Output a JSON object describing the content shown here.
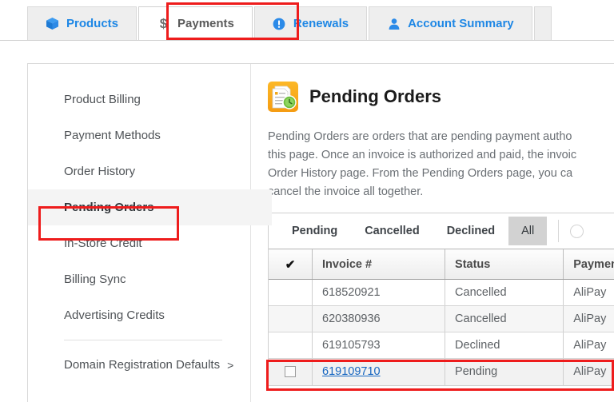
{
  "tabs": [
    {
      "label": "Products",
      "icon": "cube-icon",
      "active": false
    },
    {
      "label": "Payments",
      "icon": "dollar-icon",
      "active": true
    },
    {
      "label": "Renewals",
      "icon": "alert-circle-icon",
      "active": false
    },
    {
      "label": "Account Summary",
      "icon": "user-icon",
      "active": false
    }
  ],
  "sidebar": {
    "items": [
      {
        "label": "Product Billing",
        "active": false
      },
      {
        "label": "Payment Methods",
        "active": false
      },
      {
        "label": "Order History",
        "active": false
      },
      {
        "label": "Pending Orders",
        "active": true
      },
      {
        "label": "In-Store Credit",
        "active": false
      },
      {
        "label": "Billing Sync",
        "active": false
      },
      {
        "label": "Advertising Credits",
        "active": false
      }
    ],
    "footer_item": {
      "label": "Domain Registration Defaults",
      "chevron": ">"
    }
  },
  "main": {
    "icon": "invoice-clock-icon",
    "title": "Pending Orders",
    "intro": "Pending Orders are orders that are pending payment autho\nthis page. Once an invoice is authorized and paid, the invoic\nOrder History page. From the Pending Orders page, you ca\ncancel the invoice all together.",
    "filters": [
      {
        "label": "Pending",
        "selected": false
      },
      {
        "label": "Cancelled",
        "selected": false
      },
      {
        "label": "Declined",
        "selected": false
      },
      {
        "label": "All",
        "selected": true
      }
    ],
    "search_icon": "search-icon",
    "table": {
      "columns": [
        "",
        "Invoice #",
        "Status",
        "Payment Type"
      ],
      "header_check_icon": "checkmark-icon",
      "rows": [
        {
          "checkbox": false,
          "show_checkbox": false,
          "invoice": "618520921",
          "invoice_is_link": false,
          "status": "Cancelled",
          "payment_type": "AliPay"
        },
        {
          "checkbox": false,
          "show_checkbox": false,
          "invoice": "620380936",
          "invoice_is_link": false,
          "status": "Cancelled",
          "payment_type": "AliPay"
        },
        {
          "checkbox": false,
          "show_checkbox": false,
          "invoice": "619105793",
          "invoice_is_link": false,
          "status": "Declined",
          "payment_type": "AliPay"
        },
        {
          "checkbox": false,
          "show_checkbox": true,
          "invoice": "619109710",
          "invoice_is_link": true,
          "status": "Pending",
          "payment_type": "AliPay"
        }
      ]
    }
  },
  "annotations": {
    "color": "#ee1c1c",
    "boxes": [
      "payments-tab",
      "pending-orders-sidebar-item",
      "pending-order-row"
    ]
  }
}
